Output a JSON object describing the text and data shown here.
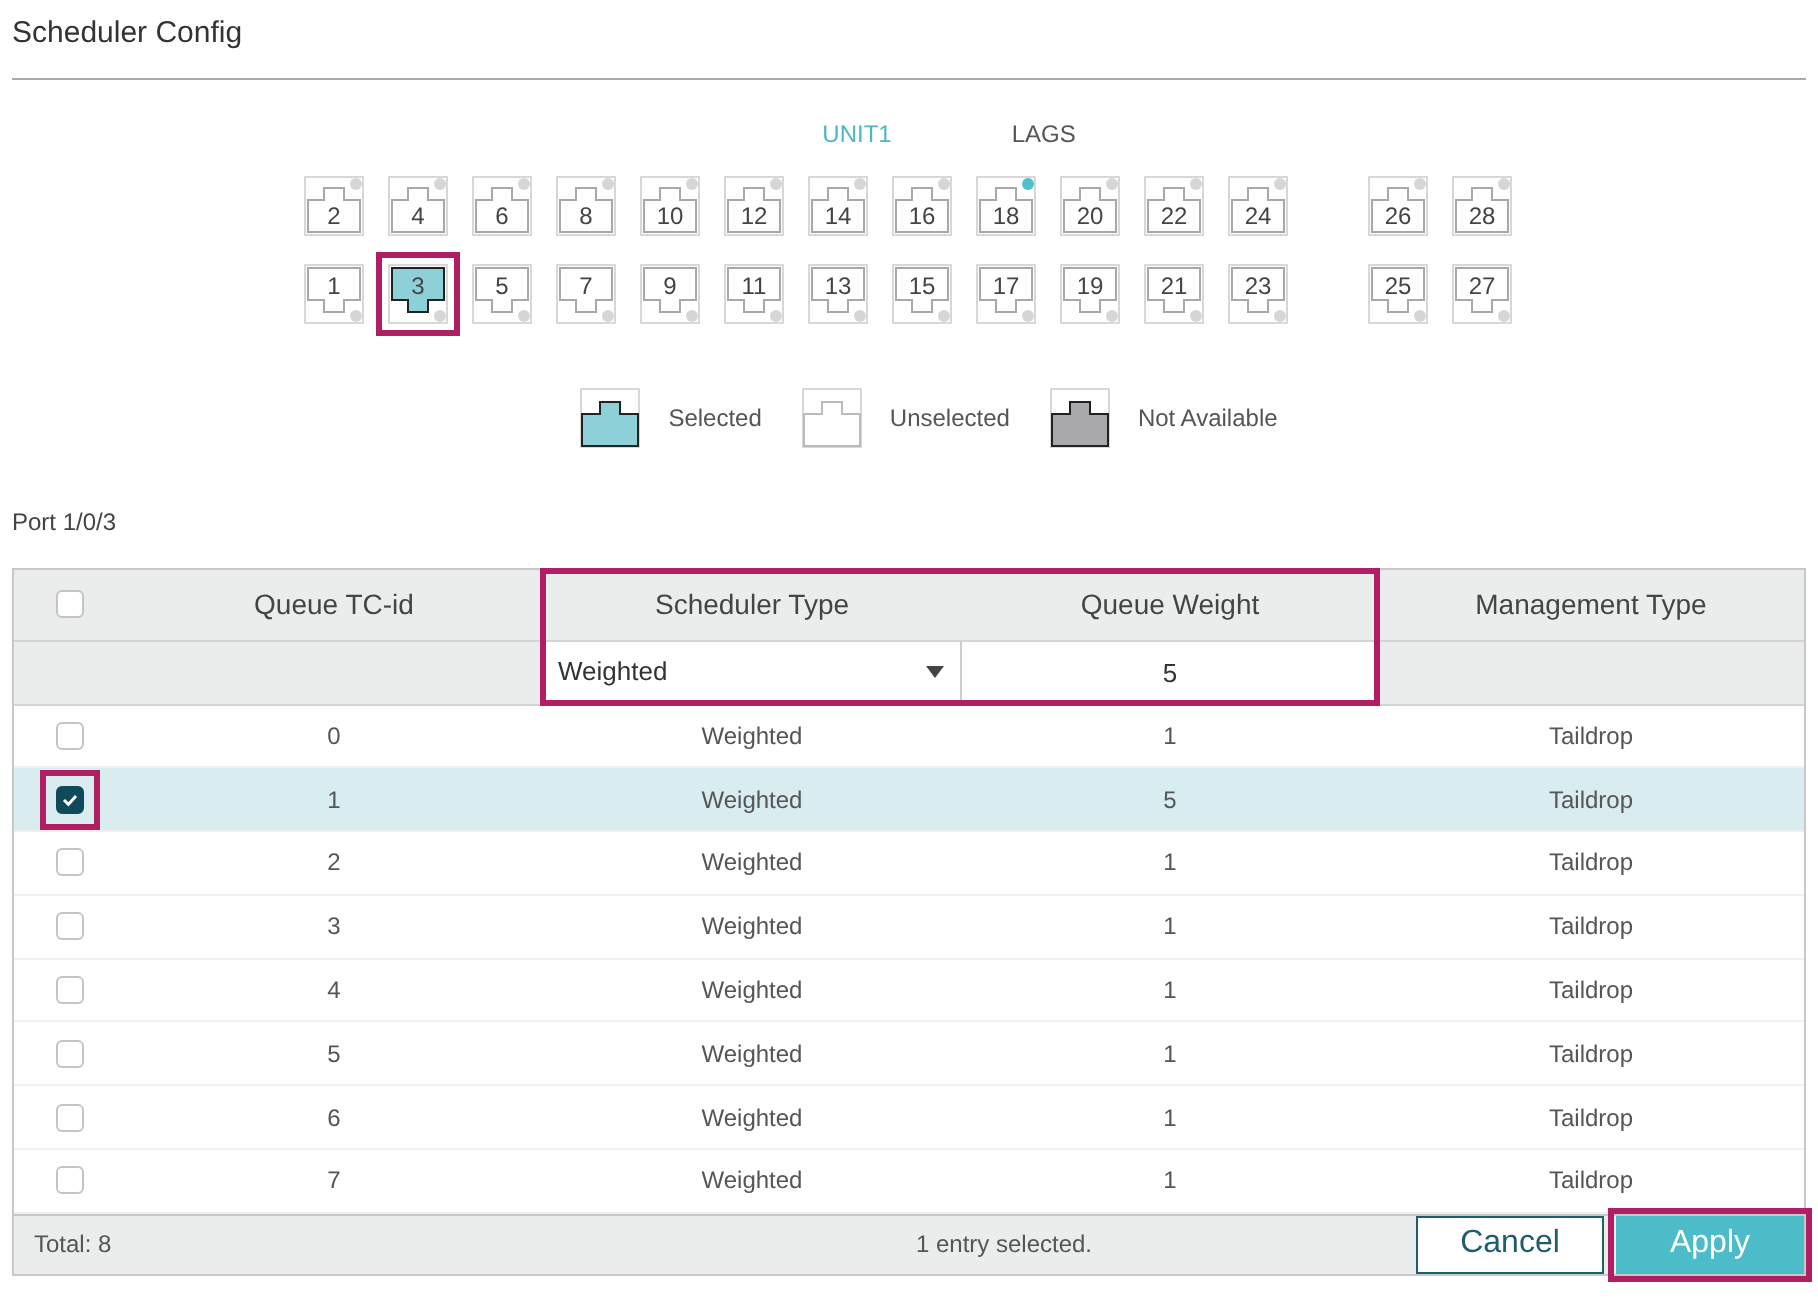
{
  "title": "Scheduler Config",
  "tabs": [
    {
      "label": "UNIT1",
      "selected": true
    },
    {
      "label": "LAGS",
      "selected": false
    }
  ],
  "port_rows": [
    {
      "kind": "top",
      "groups": [
        [
          {
            "label": "2",
            "selected": false,
            "linked": false,
            "highlighted": false
          },
          {
            "label": "4",
            "selected": false,
            "linked": false,
            "highlighted": false
          },
          {
            "label": "6",
            "selected": false,
            "linked": false,
            "highlighted": false
          },
          {
            "label": "8",
            "selected": false,
            "linked": false,
            "highlighted": false
          },
          {
            "label": "10",
            "selected": false,
            "linked": false,
            "highlighted": false
          },
          {
            "label": "12",
            "selected": false,
            "linked": false,
            "highlighted": false
          },
          {
            "label": "14",
            "selected": false,
            "linked": false,
            "highlighted": false
          },
          {
            "label": "16",
            "selected": false,
            "linked": false,
            "highlighted": false
          },
          {
            "label": "18",
            "selected": false,
            "linked": true,
            "highlighted": false
          },
          {
            "label": "20",
            "selected": false,
            "linked": false,
            "highlighted": false
          },
          {
            "label": "22",
            "selected": false,
            "linked": false,
            "highlighted": false
          },
          {
            "label": "24",
            "selected": false,
            "linked": false,
            "highlighted": false
          }
        ],
        [
          {
            "label": "26",
            "selected": false,
            "linked": false,
            "highlighted": false
          },
          {
            "label": "28",
            "selected": false,
            "linked": false,
            "highlighted": false
          }
        ]
      ]
    },
    {
      "kind": "bottom",
      "groups": [
        [
          {
            "label": "1",
            "selected": false,
            "linked": false,
            "highlighted": false
          },
          {
            "label": "3",
            "selected": true,
            "linked": false,
            "highlighted": true
          },
          {
            "label": "5",
            "selected": false,
            "linked": false,
            "highlighted": false
          },
          {
            "label": "7",
            "selected": false,
            "linked": false,
            "highlighted": false
          },
          {
            "label": "9",
            "selected": false,
            "linked": false,
            "highlighted": false
          },
          {
            "label": "11",
            "selected": false,
            "linked": false,
            "highlighted": false
          },
          {
            "label": "13",
            "selected": false,
            "linked": false,
            "highlighted": false
          },
          {
            "label": "15",
            "selected": false,
            "linked": false,
            "highlighted": false
          },
          {
            "label": "17",
            "selected": false,
            "linked": false,
            "highlighted": false
          },
          {
            "label": "19",
            "selected": false,
            "linked": false,
            "highlighted": false
          },
          {
            "label": "21",
            "selected": false,
            "linked": false,
            "highlighted": false
          },
          {
            "label": "23",
            "selected": false,
            "linked": false,
            "highlighted": false
          }
        ],
        [
          {
            "label": "25",
            "selected": false,
            "linked": false,
            "highlighted": false
          },
          {
            "label": "27",
            "selected": false,
            "linked": false,
            "highlighted": false
          }
        ]
      ]
    }
  ],
  "legend": [
    {
      "kind": "selected",
      "label": "Selected"
    },
    {
      "kind": "unselected",
      "label": "Unselected"
    },
    {
      "kind": "unavailable",
      "label": "Not Available"
    }
  ],
  "port_label": "Port 1/0/3",
  "table": {
    "all_checked": false,
    "columns": [
      "Queue TC-id",
      "Scheduler Type",
      "Queue Weight",
      "Management Type"
    ],
    "edit_highlighted": true,
    "edit_row": {
      "scheduler_type": "Weighted",
      "queue_weight": "5"
    },
    "rows": [
      {
        "selected": false,
        "highlighted": false,
        "cells": [
          "0",
          "Weighted",
          "1",
          "Taildrop"
        ]
      },
      {
        "selected": true,
        "highlighted": true,
        "cells": [
          "1",
          "Weighted",
          "5",
          "Taildrop"
        ]
      },
      {
        "selected": false,
        "highlighted": false,
        "cells": [
          "2",
          "Weighted",
          "1",
          "Taildrop"
        ]
      },
      {
        "selected": false,
        "highlighted": false,
        "cells": [
          "3",
          "Weighted",
          "1",
          "Taildrop"
        ]
      },
      {
        "selected": false,
        "highlighted": false,
        "cells": [
          "4",
          "Weighted",
          "1",
          "Taildrop"
        ]
      },
      {
        "selected": false,
        "highlighted": false,
        "cells": [
          "5",
          "Weighted",
          "1",
          "Taildrop"
        ]
      },
      {
        "selected": false,
        "highlighted": false,
        "cells": [
          "6",
          "Weighted",
          "1",
          "Taildrop"
        ]
      },
      {
        "selected": false,
        "highlighted": false,
        "cells": [
          "7",
          "Weighted",
          "1",
          "Taildrop"
        ]
      }
    ],
    "total": "Total: 8",
    "status": "1 entry selected."
  },
  "buttons": [
    {
      "kind": "cancel",
      "label": "Cancel",
      "highlighted": false
    },
    {
      "kind": "apply",
      "label": "Apply",
      "highlighted": true
    }
  ]
}
